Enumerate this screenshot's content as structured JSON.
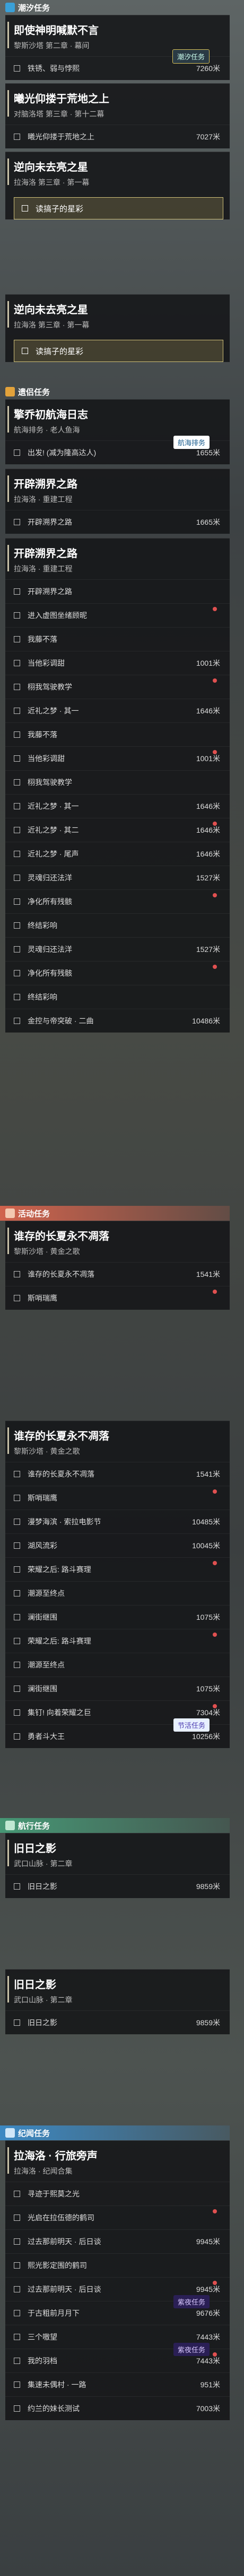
{
  "colors": {
    "tide": "#3aa0d8",
    "main": "#e2a23b",
    "event": "#e0664e",
    "sail": "#46a07a",
    "record": "#3b8fd0"
  },
  "s1": {
    "label": "潮汐任务",
    "q1": {
      "title": "即使神明喊默不言",
      "sub": "黎斯沙塔 第二章 · 幕间",
      "step": "铁锈、弱与悖熙",
      "dist": "7260米",
      "badge": "潮汐任务"
    },
    "q2": {
      "title": "曦光仰搂于荒地之上",
      "sub": "对脑洛塔 第三章 · 第十二幕",
      "step": "曦光仰搂于荒地之上",
      "dist": "7027米"
    },
    "q3": {
      "title": "逆向未去亮之星",
      "sub": "拉海洛 第三章 · 第一幕",
      "step": "读搞子的星彩"
    }
  },
  "s2": {
    "q": {
      "title": "逆向未去亮之星",
      "sub": "拉海洛 第三章 · 第一幕",
      "step": "读搞子的星彩"
    }
  },
  "s3": {
    "label": "遗侣任务",
    "q1": {
      "title": "擎乔初航海日志",
      "sub": "航海排务 · 老人鱼海",
      "step": "出发! (减为隆高达人)",
      "dist": "1655米",
      "badge": "航海排务"
    },
    "q2": {
      "title": "开辟溯界之路",
      "sub": "拉海洛 · 重建工程",
      "step": "开辟溯界之路",
      "dist": "1665米"
    },
    "q3": {
      "title": "开辟溯界之路",
      "sub": "拉海洛 · 重建工程",
      "steps": [
        {
          "t": "开辟溯界之路",
          "d": ""
        },
        {
          "t": "进入虚图坐绪顾昵",
          "d": ""
        },
        {
          "t": "我藤不落",
          "d": ""
        },
        {
          "t": "当他彩调甜",
          "d": "1001米"
        },
        {
          "t": "栩我驾驶教学",
          "d": ""
        },
        {
          "t": "近礼之梦 · 其一",
          "d": "1646米"
        },
        {
          "t": "我藤不落",
          "d": ""
        },
        {
          "t": "当他彩调甜",
          "d": "1001米"
        },
        {
          "t": "栩我驾驶教学",
          "d": ""
        },
        {
          "t": "近礼之梦 · 其一",
          "d": "1646米"
        },
        {
          "t": "近礼之梦 · 其二",
          "d": "1646米"
        },
        {
          "t": "近礼之梦 · 尾声",
          "d": "1646米"
        },
        {
          "t": "灵魂归还法洋",
          "d": "1527米"
        },
        {
          "t": "净化所有残骸",
          "d": ""
        },
        {
          "t": "终结彩响",
          "d": ""
        },
        {
          "t": "灵魂归还法洋",
          "d": "1527米"
        },
        {
          "t": "净化所有残骸",
          "d": ""
        },
        {
          "t": "终结彩响",
          "d": ""
        },
        {
          "t": "金控与帝突破 · 二曲",
          "d": "10486米"
        }
      ]
    }
  },
  "s4": {
    "label": "活动任务",
    "q": {
      "title": "谁存的长夏永不凋落",
      "sub": "黎斯沙塔 · 黄金之歌",
      "steps": [
        {
          "t": "谁存的长夏永不凋落",
          "d": "1541米"
        },
        {
          "t": "斯哨瑞鹰",
          "d": ""
        }
      ]
    }
  },
  "s5": {
    "q": {
      "title": "谁存的长夏永不凋落",
      "sub": "黎斯沙塔 · 黄金之歌",
      "steps": [
        {
          "t": "谁存的长夏永不凋落",
          "d": "1541米"
        },
        {
          "t": "斯哨瑞鹰",
          "d": ""
        },
        {
          "t": "漫梦海滨 · 索拉电影节",
          "d": "10485米"
        },
        {
          "t": "湖风流彩",
          "d": "10045米"
        },
        {
          "t": "荣耀之后: 路斗赛理",
          "d": ""
        },
        {
          "t": "潮源至终点",
          "d": ""
        },
        {
          "t": "澜街继围",
          "d": "1075米"
        },
        {
          "t": "荣耀之后: 路斗赛理",
          "d": ""
        },
        {
          "t": "潮源至终点",
          "d": ""
        },
        {
          "t": "澜街继围",
          "d": "1075米"
        },
        {
          "t": "集钉! 向着荣耀之巨",
          "d": "7304米"
        },
        {
          "t": "勇者斗大王",
          "d": "10256米"
        }
      ],
      "badge": "节活任务"
    }
  },
  "s6": {
    "label": "航行任务",
    "q": {
      "title": "旧日之影",
      "sub": "武口山脉 · 第二章",
      "step": "旧日之影",
      "dist": "9859米"
    }
  },
  "s7": {
    "q": {
      "title": "旧日之影",
      "sub": "武口山脉 · 第二章",
      "step": "旧日之影",
      "dist": "9859米"
    }
  },
  "s8": {
    "label": "纪闻任务",
    "q": {
      "title": "拉海洛 · 行旅旁声",
      "sub": "拉海洛 · 纪闻合集",
      "steps": [
        {
          "t": "寻迹于熙莫之光",
          "d": ""
        },
        {
          "t": "光启在拉伍德的鹤司",
          "d": ""
        },
        {
          "t": "过去那前明天 · 后日谈",
          "d": "9945米"
        },
        {
          "t": "熙光影定围的鹤司",
          "d": ""
        },
        {
          "t": "过去那前明天 · 后日谈",
          "d": "9945米"
        },
        {
          "t": "于古粗前月月下",
          "d": "9676米"
        },
        {
          "t": "三个嗷望",
          "d": "7443米"
        },
        {
          "t": "我的羽档",
          "d": "7443米"
        },
        {
          "t": "集速未偶村 · 一路",
          "d": "951米"
        },
        {
          "t": "约兰的妹长测试",
          "d": "7003米"
        }
      ],
      "badge1": "紫夜任务",
      "badge2": "紫夜任务"
    }
  }
}
